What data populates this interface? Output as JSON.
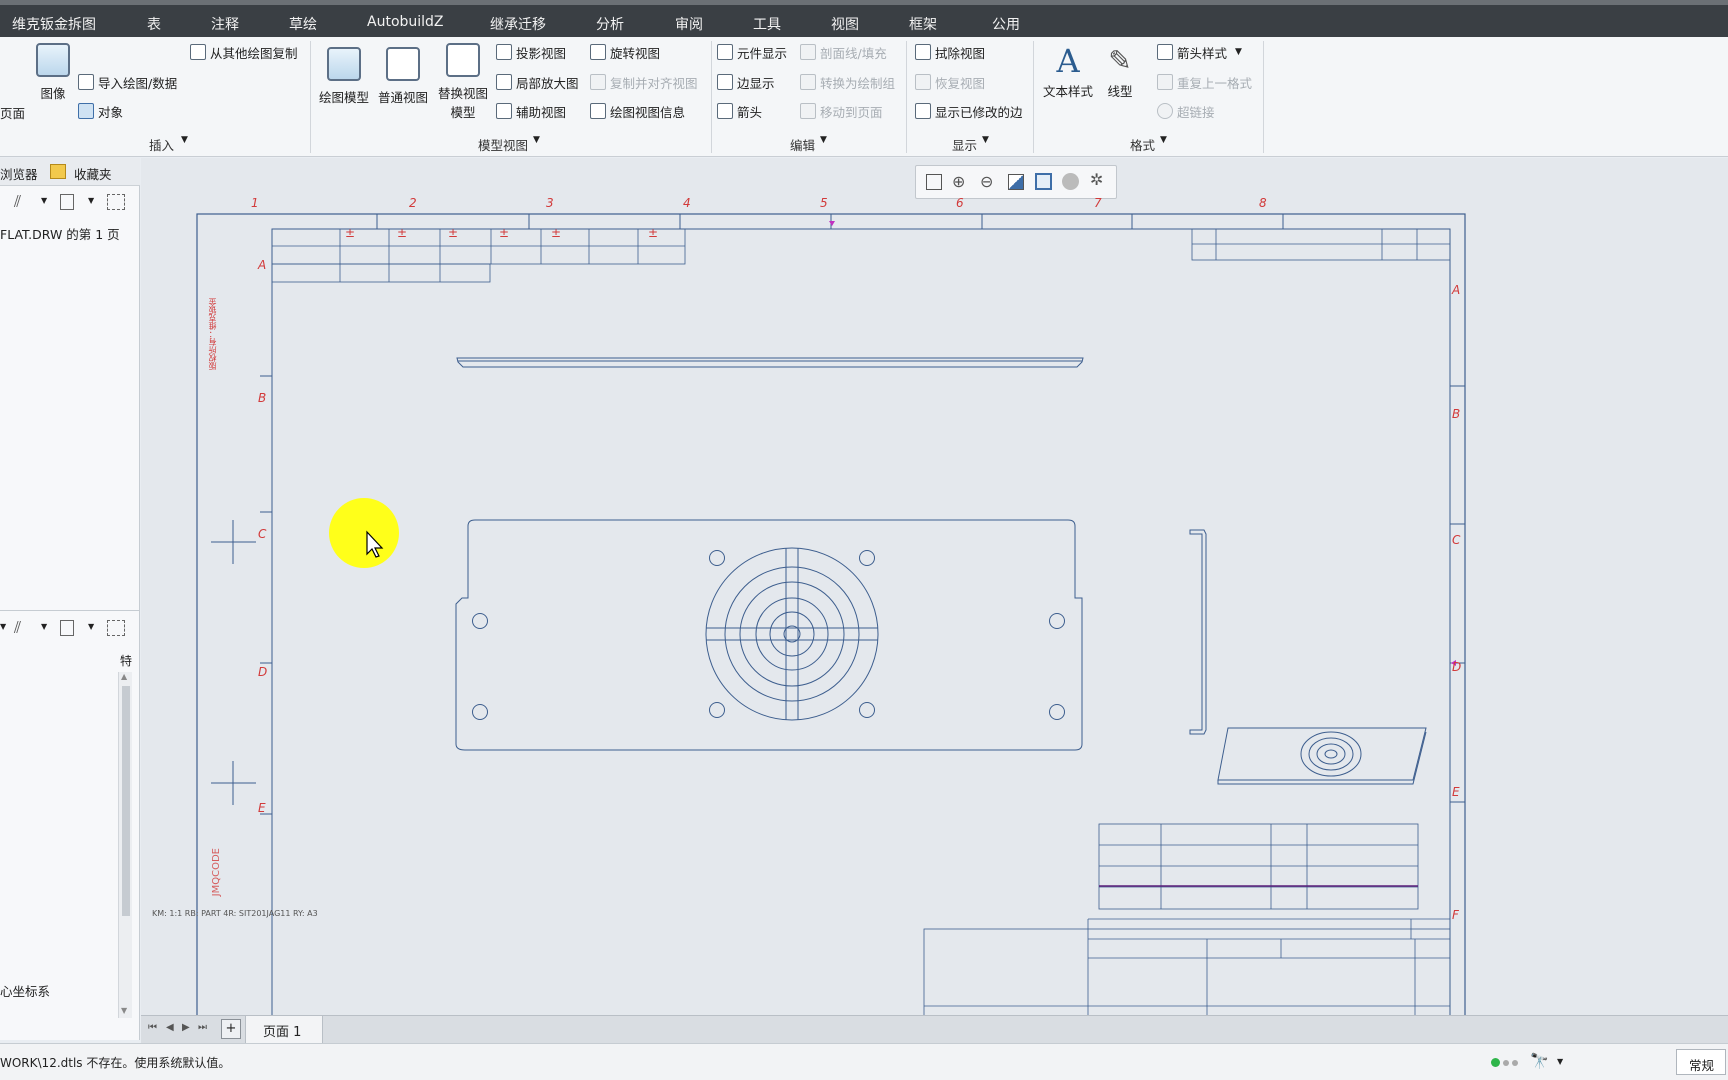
{
  "menubar": {
    "items": [
      "维克钣金拆图",
      "表",
      "注释",
      "草绘",
      "AutobuildZ",
      "继承迁移",
      "分析",
      "审阅",
      "工具",
      "视图",
      "框架",
      "公用"
    ]
  },
  "ribbon": {
    "insert": {
      "page_label": "页面",
      "image_label": "图像",
      "copy_from_other": "从其他绘图复制",
      "import_drawing": "导入绘图/数据",
      "object": "对象",
      "group": "插入"
    },
    "model_views": {
      "drawing_model": "绘图模型",
      "general_view": "普通视图",
      "replace_view_line1": "替换视图",
      "replace_view_line2": "模型",
      "projection_view": "投影视图",
      "detail_view": "局部放大图",
      "auxiliary_view": "辅助视图",
      "revolved_view": "旋转视图",
      "copy_align_view": "复制并对齐视图",
      "view_info": "绘图视图信息",
      "group": "模型视图"
    },
    "edit": {
      "component_display": "元件显示",
      "edge_display": "边显示",
      "arrow": "箭头",
      "section_fill": "剖面线/填充",
      "convert_group": "转换为绘制组",
      "move_to_page": "移动到页面",
      "group": "编辑"
    },
    "display": {
      "erase_view": "拭除视图",
      "restore_view": "恢复视图",
      "show_modified_edges": "显示已修改的边",
      "group": "显示"
    },
    "format": {
      "text_style": "文本样式",
      "line_style": "线型",
      "arrow_style": "箭头样式",
      "repeat_format": "重复上一格式",
      "hyperlink": "超链接",
      "group": "格式"
    }
  },
  "leftpanel": {
    "tab_browser": "浏览器",
    "tab_favorites": "收藏夹",
    "tree_item": "FLAT.DRW 的第 1 页",
    "feature_col": "特",
    "csys_item": "心坐标系"
  },
  "sheet": {
    "top_zones": [
      "1",
      "2",
      "3",
      "4",
      "5",
      "6",
      "7",
      "8"
    ],
    "left_zones": [
      "A",
      "B",
      "C",
      "D",
      "E"
    ],
    "right_zones": [
      "A",
      "B",
      "C",
      "D",
      "E",
      "F"
    ],
    "vertical_text": "版权所有：维克钣金",
    "vertical_code": "JMQCODE",
    "plusminus": "±",
    "bottom_info": "KM: 1:1   RB: PART   4R: SIT201JAG11   RY: A3"
  },
  "pagebar": {
    "page_label": "页面 1",
    "add_label": "+"
  },
  "statusbar": {
    "message": "WORK\\12.dtls 不存在。使用系统默认值。",
    "mode": "常规"
  }
}
